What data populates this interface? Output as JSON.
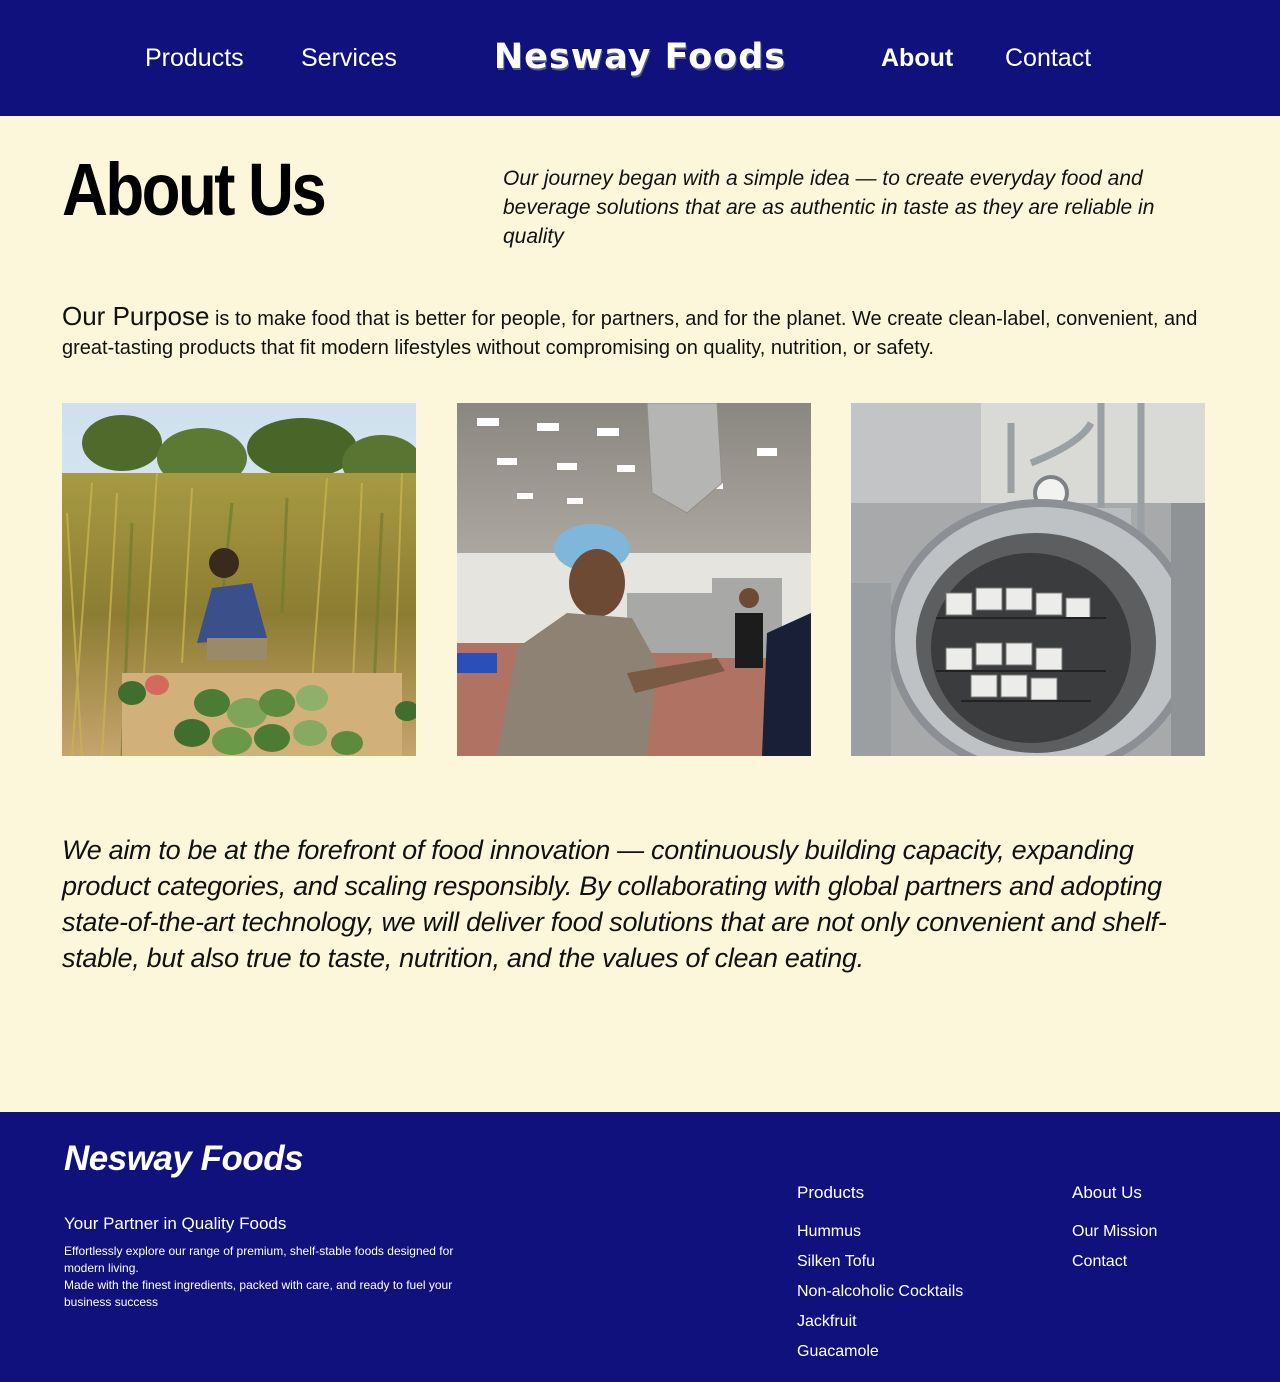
{
  "header": {
    "nav_left": [
      {
        "label": "Products"
      },
      {
        "label": "Services"
      }
    ],
    "logo": "Nesway Foods",
    "nav_right": [
      {
        "label": "About",
        "active": true
      },
      {
        "label": "Contact"
      }
    ],
    "background_color": "#10117d"
  },
  "main": {
    "title": "About Us",
    "intro": " Our journey began with a simple idea — to create everyday food and beverage solutions that are as authentic in taste as they are reliable in quality",
    "purpose_lead": "Our Purpose",
    "purpose_text": " is to make food that is better for people, for partners, and for the planet. We create clean-label, convenient, and great-tasting products that fit modern lifestyles without compromising on quality, nutrition, or safety.",
    "vision": "We aim to be at the forefront of food innovation — continuously building capacity, expanding product categories, and scaling responsibly. By collaborating with global partners and adopting state-of-the-art technology, we will deliver food solutions that are not only convenient and shelf-stable, but also true to taste, nutrition, and the values of clean eating.",
    "background_color": "#fcf7da"
  },
  "footer": {
    "brand": "Nesway Foods",
    "tagline": "Your Partner in Quality Foods",
    "description_1": "Effortlessly explore our range of premium, shelf-stable foods designed for modern living.",
    "description_2": "Made with the finest ingredients, packed with care, and ready to fuel your business success",
    "products_title": "Products",
    "products": [
      {
        "label": "Hummus"
      },
      {
        "label": "Silken Tofu"
      },
      {
        "label": "Non-alcoholic Cocktails"
      },
      {
        "label": "Jackfruit"
      },
      {
        "label": "Guacamole"
      }
    ],
    "about_title": "About Us",
    "about_links": [
      {
        "label": "Our Mission"
      },
      {
        "label": "Contact"
      }
    ]
  }
}
